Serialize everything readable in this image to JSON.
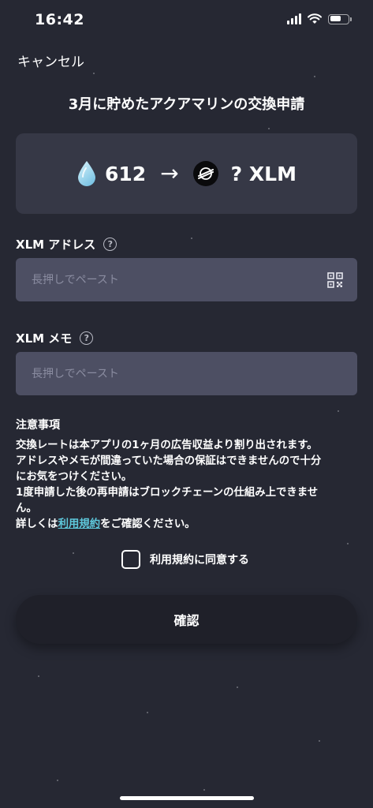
{
  "status_bar": {
    "time": "16:42"
  },
  "header": {
    "cancel_label": "キャンセル",
    "title": "3月に貯めたアクアマリンの交換申請"
  },
  "exchange": {
    "from_amount": "612",
    "arrow": "→",
    "to_amount": "? XLM",
    "from_icon": "water-drop-icon",
    "to_icon": "stellar-icon"
  },
  "address_field": {
    "label": "XLM アドレス",
    "placeholder": "長押しでペースト",
    "value": ""
  },
  "memo_field": {
    "label": "XLM メモ",
    "placeholder": "長押しでペースト",
    "value": ""
  },
  "help_symbol": "?",
  "notice": {
    "title": "注意事項",
    "lines": [
      "交換レートは本アプリの1ヶ月の広告収益より割り出されます。",
      "アドレスやメモが間違っていた場合の保証はできませんので十分",
      "にお気をつけください。",
      "1度申請した後の再申請はブロックチェーンの仕組み上できませ",
      "ん。"
    ],
    "last_line_prefix": "詳しくは",
    "terms_link": "利用規約",
    "last_line_suffix": "をご確認ください。"
  },
  "agree": {
    "label": "利用規約に同意する",
    "checked": false
  },
  "confirm_label": "確認",
  "colors": {
    "background": "#262833",
    "card": "#363846",
    "input": "#4d4f63",
    "link": "#5ec8dc",
    "button": "#1f2029"
  }
}
